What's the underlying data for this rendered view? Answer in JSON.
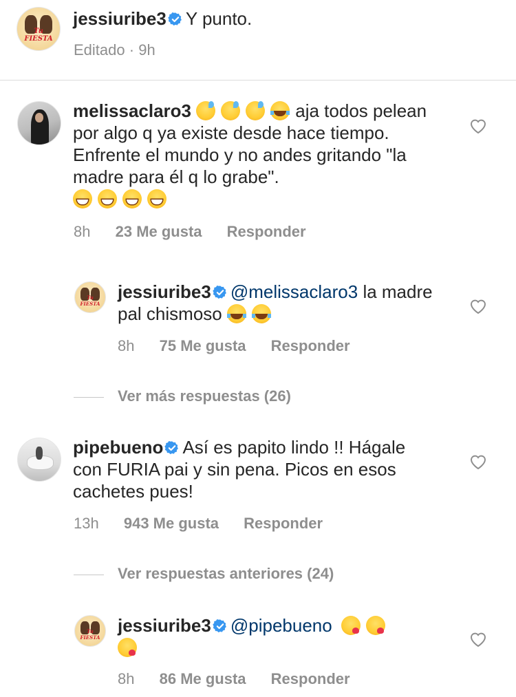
{
  "post": {
    "username": "jessiuribe3",
    "caption": "Y punto.",
    "edited_label": "Editado",
    "separator": "·",
    "time": "9h"
  },
  "comments": [
    {
      "username": "melissaclaro3",
      "text_after_emojis": "aja todos pelean por algo q ya existe desde hace tiempo. Enfrente el mundo y no andes gritando \"la madre para él q lo grabe\".",
      "time": "8h",
      "likes": "23 Me gusta",
      "reply_label": "Responder"
    },
    {
      "username": "jessiuribe3",
      "mention": "@melissaclaro3",
      "text": "la madre pal chismoso",
      "time": "8h",
      "likes": "75 Me gusta",
      "reply_label": "Responder"
    },
    {
      "username": "pipebueno",
      "text": "Así es papito lindo !! Hágale con FURIA pai y sin pena. Picos en esos cachetes pues!",
      "time": "13h",
      "likes": "943 Me gusta",
      "reply_label": "Responder"
    },
    {
      "username": "jessiuribe3",
      "mention": "@pipebueno",
      "text": "",
      "time": "8h",
      "likes": "86 Me gusta",
      "reply_label": "Responder"
    }
  ],
  "view_more_replies": "Ver más respuestas (26)",
  "view_previous_replies": "Ver respuestas anteriores (24)",
  "avatar_tag": "Tu FIESTA",
  "icons": {
    "verified": "verified-badge-icon",
    "like": "heart-outline-icon"
  },
  "colors": {
    "text": "#262626",
    "secondary": "#8e8e8e",
    "verified": "#3897f0",
    "mention": "#00376b"
  }
}
